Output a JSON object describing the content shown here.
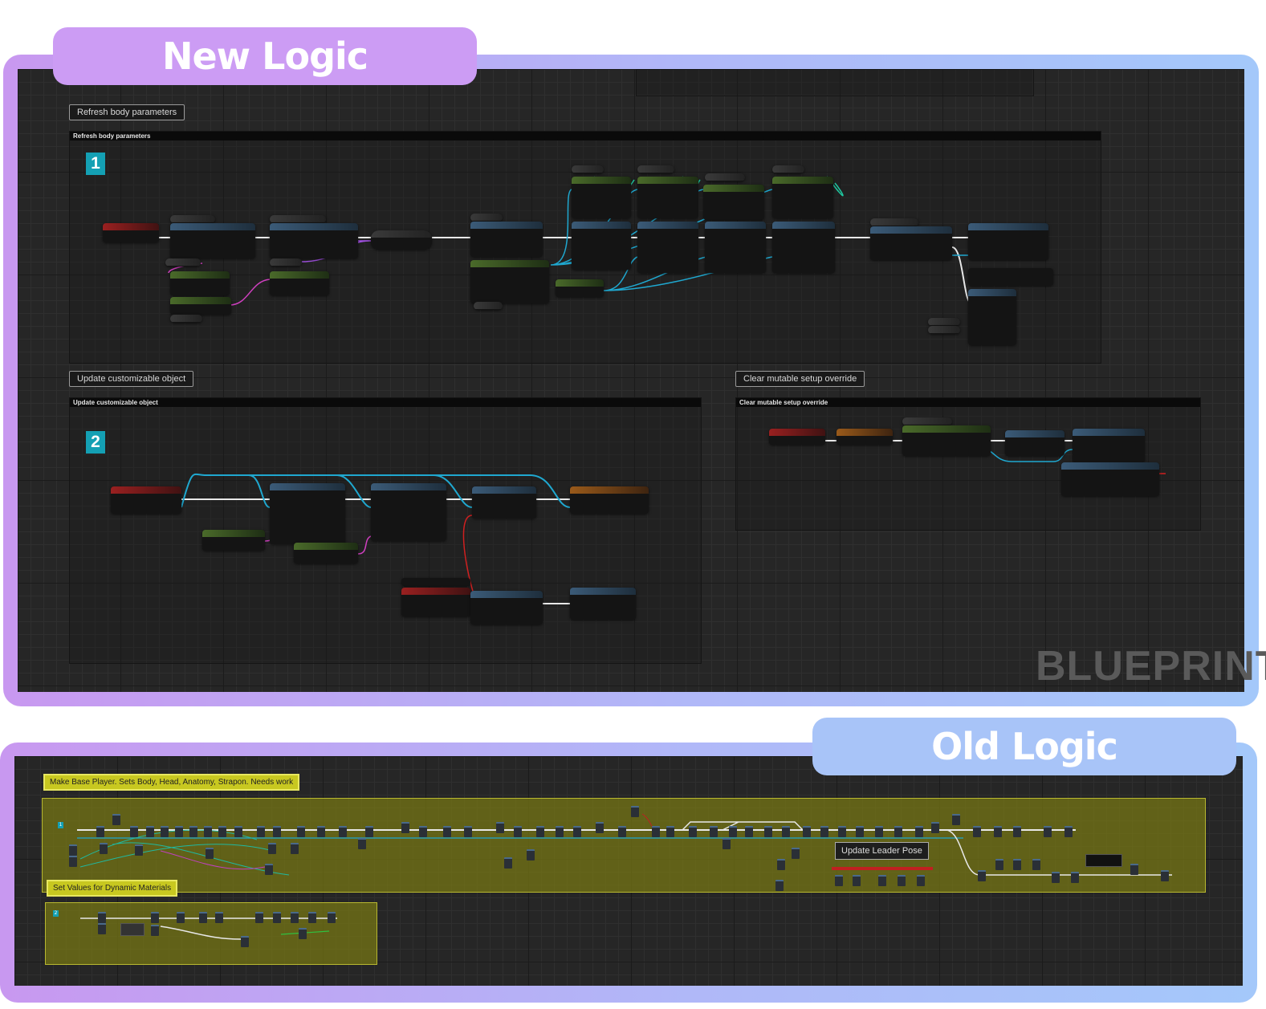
{
  "headings": {
    "new_logic": "New Logic",
    "old_logic": "Old Logic"
  },
  "watermark": "BLUEPRINT",
  "colors": {
    "accent_purple": "#cc9cf4",
    "accent_blue": "#a8c4f8",
    "comment_yellow": "#c8c820"
  },
  "new_graph": {
    "comments": [
      {
        "bubble": "Refresh body parameters",
        "header": "Refresh body parameters",
        "badge": "1"
      },
      {
        "bubble": "Update customizable object",
        "header": "Update customizable object",
        "badge": "2"
      },
      {
        "bubble": "Clear mutable setup override",
        "header": "Clear mutable setup override"
      }
    ]
  },
  "old_graph": {
    "comments": [
      {
        "bubble": "Make Base Player. Sets Body, Head, Anatomy, Strapon. Needs work",
        "badge": "1"
      },
      {
        "bubble": "Set Values for Dynamic Materials",
        "badge": "2"
      }
    ],
    "inner_label": "Update Leader Pose"
  }
}
